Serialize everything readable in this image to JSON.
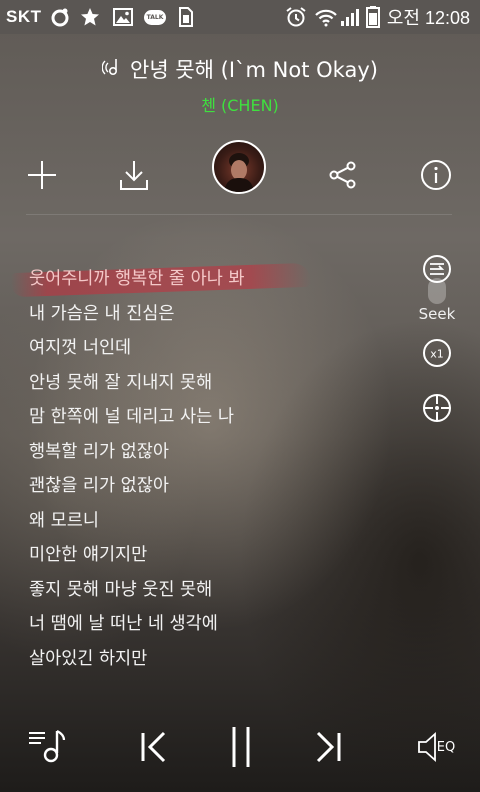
{
  "status_bar": {
    "carrier": "SKT",
    "talk_badge": "TALK",
    "time": "오전 12:08",
    "icons": [
      "circle-notification-icon",
      "star-icon",
      "gallery-icon",
      "talk-icon",
      "sim-icon",
      "alarm-icon",
      "wifi-icon",
      "signal-icon",
      "battery-icon"
    ]
  },
  "song": {
    "title": "안녕 못해 (I`m Not Okay)",
    "artist": "첸 (CHEN)",
    "artist_color": "#3fe03f"
  },
  "actions": {
    "icons": [
      "add-icon",
      "download-icon",
      "album-art",
      "share-icon",
      "info-icon"
    ]
  },
  "lyrics": {
    "current_index": 0,
    "lines": [
      "웃어주니까 행복한 줄 아나 봐",
      "내 가슴은 내 진심은",
      "여지껏 너인데",
      "안녕 못해 잘 지내지 못해",
      "맘 한쪽에 널 데리고 사는 나",
      "행복할 리가 없잖아",
      "괜찮을 리가 없잖아",
      "왜 모르니",
      "미안한 얘기지만",
      "좋지 못해 마냥 웃진 못해",
      "너 땜에 날 떠난 네 생각에",
      "살아있긴 하지만"
    ],
    "highlight_color": "#c82d3c"
  },
  "side_controls": {
    "seek_label": "Seek",
    "speed_label": "x1",
    "icons": [
      "lyrics-scroll-icon",
      "speed-icon",
      "crosshair-icon"
    ]
  },
  "player": {
    "eq_label": "EQ",
    "icons": [
      "playlist-icon",
      "previous-icon",
      "pause-icon",
      "next-icon",
      "equalizer-icon"
    ]
  }
}
